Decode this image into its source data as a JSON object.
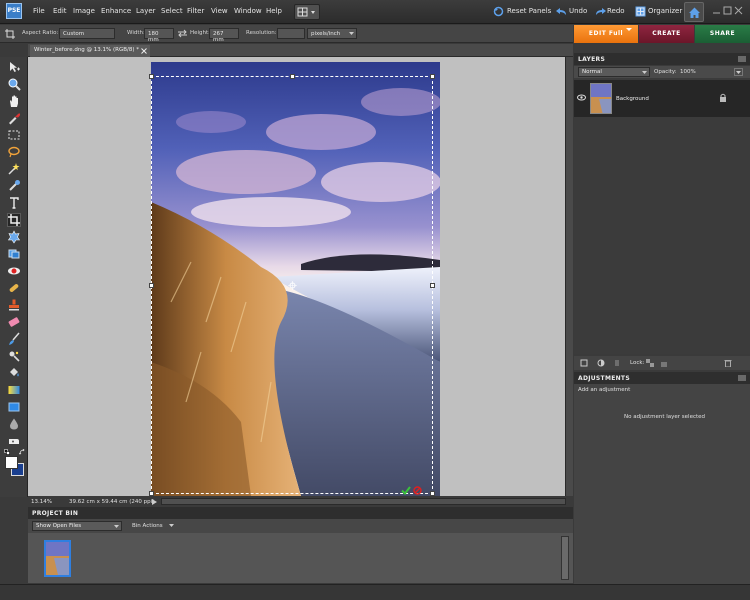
{
  "app": {
    "logo_text": "PSE"
  },
  "menu": [
    "File",
    "Edit",
    "Image",
    "Enhance",
    "Layer",
    "Select",
    "Filter",
    "View",
    "Window",
    "Help"
  ],
  "top_tools": {
    "reset_panels": "Reset Panels",
    "undo": "Undo",
    "redo": "Redo",
    "organizer": "Organizer"
  },
  "options_bar": {
    "aspect_ratio_label": "Aspect Ratio:",
    "aspect_ratio_value": "Custom",
    "width_label": "Width:",
    "width_value": "180 mm",
    "height_label": "Height:",
    "height_value": "267 mm",
    "resolution_label": "Resolution:",
    "resolution_value": "",
    "resolution_unit": "pixels/inch"
  },
  "mode_tabs": {
    "edit": "EDIT Full",
    "create": "CREATE",
    "share": "SHARE"
  },
  "document": {
    "tab_title": "Winter_before.dng @ 13.1% (RGB/8) *"
  },
  "status": {
    "zoom": "13.14%",
    "doc_info": "39.62 cm x 59.44 cm (240 ppi)"
  },
  "project_bin": {
    "title": "PROJECT BIN",
    "show_label": "Show Open Files",
    "actions_label": "Bin Actions"
  },
  "layers_panel": {
    "title": "LAYERS",
    "blend_mode": "Normal",
    "opacity_label": "Opacity:",
    "opacity_value": "100%",
    "layer_name": "Background",
    "lock_label": "Lock:"
  },
  "adjustments_panel": {
    "title": "ADJUSTMENTS",
    "subtitle": "Add an adjustment",
    "empty_message": "No adjustment layer selected"
  },
  "colors": {
    "edit_tab": "#f07f1a",
    "create_tab": "#7a1a32",
    "share_tab": "#1f6a3a",
    "accent_blue": "#3a7ec8"
  }
}
